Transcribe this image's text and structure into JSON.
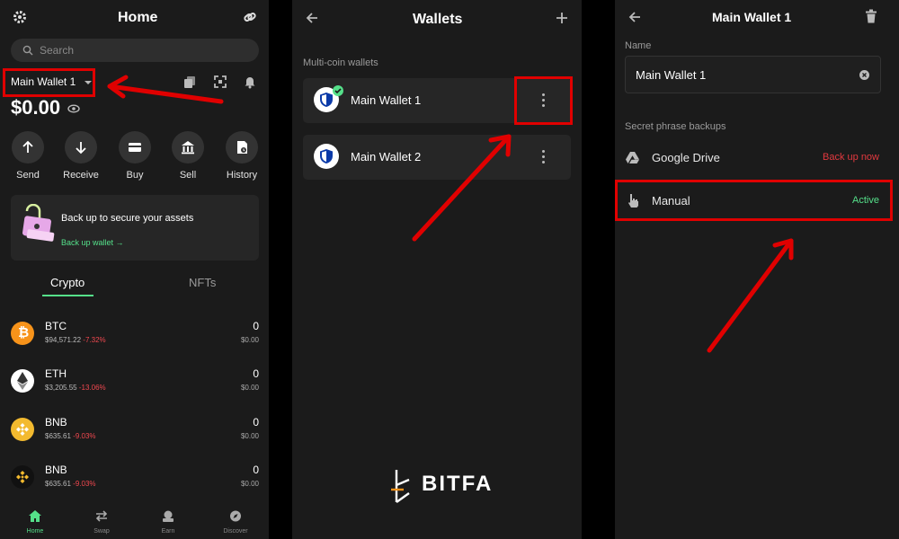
{
  "home": {
    "title": "Home",
    "search_placeholder": "Search",
    "wallet_selector": "Main Wallet 1",
    "balance": "$0.00",
    "actions": [
      {
        "label": "Send",
        "icon": "arrow-up-icon"
      },
      {
        "label": "Receive",
        "icon": "arrow-down-icon"
      },
      {
        "label": "Buy",
        "icon": "card-icon"
      },
      {
        "label": "Sell",
        "icon": "bank-icon"
      },
      {
        "label": "History",
        "icon": "history-icon"
      }
    ],
    "backup_card": {
      "title": "Back up to secure your assets",
      "link": "Back up wallet →"
    },
    "tabs": [
      {
        "label": "Crypto",
        "active": true
      },
      {
        "label": "NFTs",
        "active": false
      }
    ],
    "coins": [
      {
        "symbol": "BTC",
        "price": "$94,571.22",
        "change": "-7.32%",
        "amount": "0",
        "value": "$0.00",
        "icon_color": "#f7931a"
      },
      {
        "symbol": "ETH",
        "price": "$3,205.55",
        "change": "-13.06%",
        "amount": "0",
        "value": "$0.00",
        "icon_color": "#ffffff"
      },
      {
        "symbol": "BNB",
        "price": "$635.61",
        "change": "-9.03%",
        "amount": "0",
        "value": "$0.00",
        "icon_color": "#f3ba2f"
      },
      {
        "symbol": "BNB",
        "price": "$635.61",
        "change": "-9.03%",
        "amount": "0",
        "value": "$0.00",
        "icon_color": "#111111"
      }
    ],
    "nav": [
      {
        "label": "Home",
        "active": true
      },
      {
        "label": "Swap",
        "active": false
      },
      {
        "label": "Earn",
        "active": false
      },
      {
        "label": "Discover",
        "active": false
      }
    ]
  },
  "wallets": {
    "title": "Wallets",
    "section": "Multi-coin wallets",
    "items": [
      {
        "name": "Main Wallet 1",
        "selected": true
      },
      {
        "name": "Main Wallet 2",
        "selected": false
      }
    ],
    "brand": "BITFA"
  },
  "wallet_detail": {
    "title": "Main Wallet 1",
    "name_label": "Name",
    "name_value": "Main Wallet 1",
    "section": "Secret phrase backups",
    "options": [
      {
        "label": "Google Drive",
        "status": "Back up now",
        "status_color": "#e2393f"
      },
      {
        "label": "Manual",
        "status": "Active",
        "status_color": "#55e08a"
      }
    ]
  },
  "colors": {
    "accent": "#55e08a",
    "negative": "#f0484f",
    "annotation": "#e00000"
  }
}
